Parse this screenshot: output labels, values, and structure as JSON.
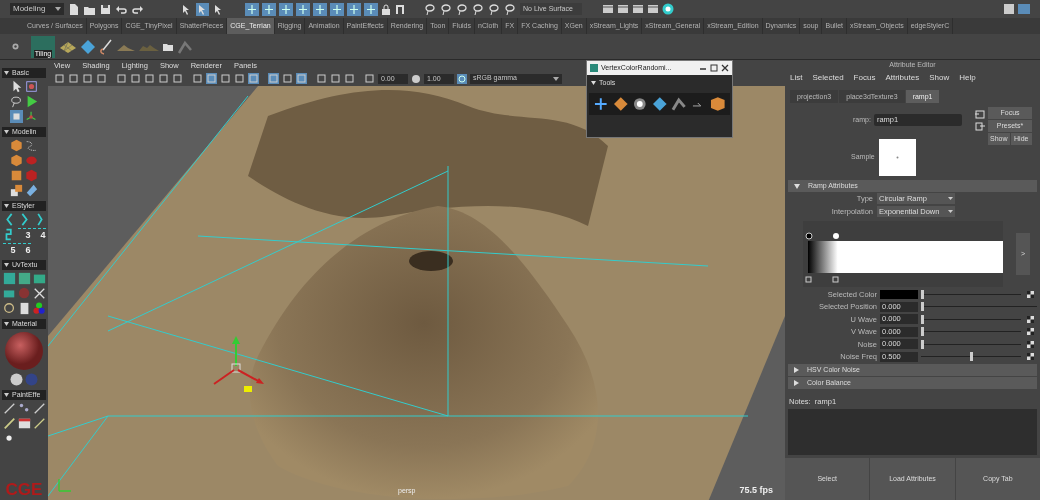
{
  "status_line": {
    "mode": "Modeling",
    "live_surface": "No Live Surface"
  },
  "shelf": {
    "tabs": [
      {
        "label": "Curves / Surfaces",
        "selected": false
      },
      {
        "label": "Polygons",
        "selected": false
      },
      {
        "label": "CGE_TinyPixel",
        "selected": false
      },
      {
        "label": "ShatterPieces",
        "selected": false
      },
      {
        "label": "CGE_Terrian",
        "selected": true
      },
      {
        "label": "Rigging",
        "selected": false
      },
      {
        "label": "Animation",
        "selected": false
      },
      {
        "label": "PaintEffects",
        "selected": false
      },
      {
        "label": "Rendering",
        "selected": false
      },
      {
        "label": "Toon",
        "selected": false
      },
      {
        "label": "Fluids",
        "selected": false
      },
      {
        "label": "nCloth",
        "selected": false
      },
      {
        "label": "FX",
        "selected": false
      },
      {
        "label": "FX Caching",
        "selected": false
      },
      {
        "label": "XGen",
        "selected": false
      },
      {
        "label": "xStream_Lights",
        "selected": false
      },
      {
        "label": "xStream_General",
        "selected": false
      },
      {
        "label": "xStream_Edition",
        "selected": false
      },
      {
        "label": "Dynamics",
        "selected": false
      },
      {
        "label": "soup",
        "selected": false
      },
      {
        "label": "Bullet",
        "selected": false
      },
      {
        "label": "xStream_Objects",
        "selected": false
      },
      {
        "label": "edgeStylerC",
        "selected": false
      }
    ],
    "first_item_label": "Tiling"
  },
  "toolbox": {
    "sections": [
      {
        "title": "Basic"
      },
      {
        "title": "Modelin"
      },
      {
        "title": "EStyler",
        "numbers": [
          "3",
          "4",
          "5",
          "6"
        ]
      },
      {
        "title": "UvTextu"
      },
      {
        "title": "Material"
      },
      {
        "title": "PaintEffe"
      }
    ],
    "logo": "CGE"
  },
  "viewport": {
    "menus": [
      "View",
      "Shading",
      "Lighting",
      "Show",
      "Renderer",
      "Panels"
    ],
    "exposure": "0.00",
    "gamma": "1.00",
    "color_space": "sRGB gamma",
    "camera": "persp",
    "fps": "75.5 fps"
  },
  "tool_window": {
    "title": "VertexColorRandomi...",
    "section": "Tools"
  },
  "attribute_editor": {
    "title": "Attribute Editor",
    "menus": [
      "List",
      "Selected",
      "Focus",
      "Attributes",
      "Show",
      "Help"
    ],
    "tabs": [
      {
        "label": "projection3",
        "selected": false
      },
      {
        "label": "place3dTexture3",
        "selected": false
      },
      {
        "label": "ramp1",
        "selected": true
      }
    ],
    "node_label": "ramp:",
    "node_name": "ramp1",
    "buttons": [
      "Focus",
      "Presets*",
      "Show",
      "Hide"
    ],
    "sample_label": "Sample",
    "ramp_section": {
      "title": "Ramp Attributes",
      "expanded": true,
      "type_label": "Type",
      "type_value": "Circular Ramp",
      "interpolation_label": "Interpolation",
      "interpolation_value": "Exponential Down",
      "expand_button": ">"
    },
    "fields": [
      {
        "kind": "color",
        "label": "Selected Color",
        "color": "#000000",
        "level": 0,
        "map_button": true
      },
      {
        "kind": "number",
        "label": "Selected Position",
        "value": "0.000",
        "level": 0,
        "map_button": false
      },
      {
        "kind": "number",
        "label": "U Wave",
        "value": "0.000",
        "level": 0,
        "map_button": true
      },
      {
        "kind": "number",
        "label": "V Wave",
        "value": "0.000",
        "level": 0,
        "map_button": true
      },
      {
        "kind": "number",
        "label": "Noise",
        "value": "0.000",
        "level": 0,
        "map_button": true
      },
      {
        "kind": "number",
        "label": "Noise Freq",
        "value": "0.500",
        "level": 0.5,
        "map_button": true
      }
    ],
    "sections": [
      {
        "title": "HSV Color Noise",
        "expanded": false
      },
      {
        "title": "Color Balance",
        "expanded": false
      }
    ],
    "notes_label": "Notes:  ramp1",
    "bottom_buttons": [
      "Select",
      "Load Attributes",
      "Copy Tab"
    ]
  }
}
